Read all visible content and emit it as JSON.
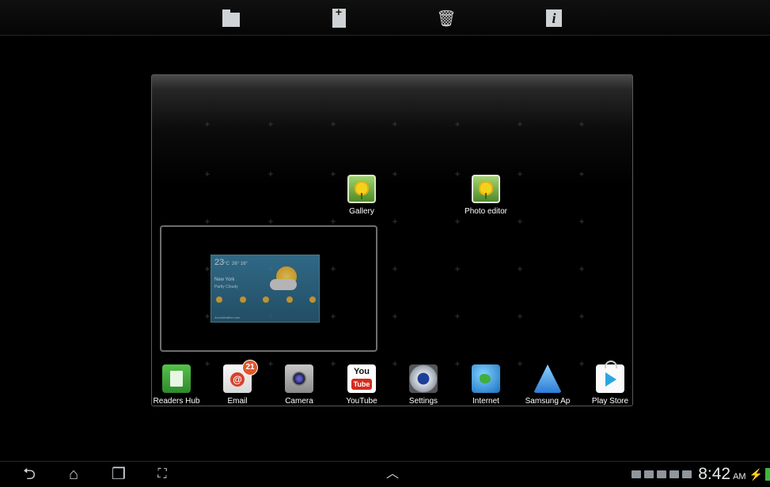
{
  "toolbar": {
    "items": [
      {
        "name": "create-folder",
        "icon": "folder-icon"
      },
      {
        "name": "add-page",
        "icon": "add-page-icon"
      },
      {
        "name": "delete",
        "icon": "trash-icon",
        "glyph": "🗑"
      },
      {
        "name": "info",
        "icon": "info-icon",
        "glyph": "i"
      }
    ]
  },
  "home_page": {
    "apps": [
      {
        "label": "Gallery",
        "icon": "gallery-icon"
      },
      {
        "label": "Photo editor",
        "icon": "photo-editor-icon"
      }
    ],
    "weather_widget": {
      "temp": "23",
      "unit": "°C",
      "range": "26° 16°",
      "city": "New York",
      "condition": "Partly Cloudy",
      "footer": "AccuWeather.com"
    }
  },
  "dock": {
    "apps": [
      {
        "label": "Readers Hub",
        "icon": "readers-hub-icon"
      },
      {
        "label": "Email",
        "icon": "email-icon",
        "badge": "21"
      },
      {
        "label": "Camera",
        "icon": "camera-icon"
      },
      {
        "label": "YouTube",
        "icon": "youtube-icon",
        "you": "You",
        "tube": "Tube"
      },
      {
        "label": "Settings",
        "icon": "settings-icon"
      },
      {
        "label": "Internet",
        "icon": "internet-icon"
      },
      {
        "label": "Samsung Ap",
        "icon": "samsung-apps-icon"
      },
      {
        "label": "Play Store",
        "icon": "play-store-icon"
      }
    ]
  },
  "navbar": {
    "back": "⮌",
    "home": "⌂",
    "recent": "❒",
    "screenshot": "⛶",
    "up": "︿"
  },
  "status": {
    "time": "8:42",
    "ampm": "AM"
  },
  "colors": {
    "background": "#000000",
    "panel_border": "#5a5a5a",
    "battery": "#3cb83c",
    "wifi": "#d9a12c"
  }
}
